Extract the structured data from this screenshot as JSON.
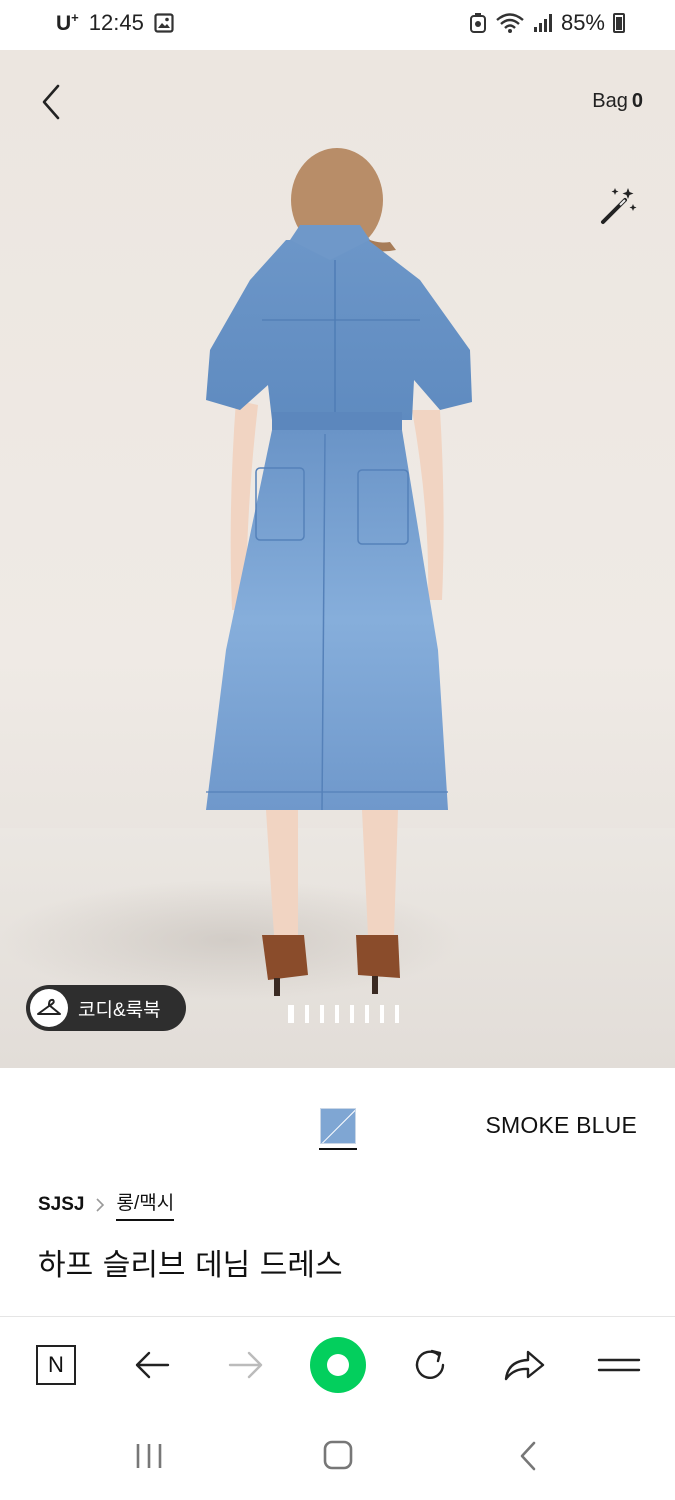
{
  "status_bar": {
    "carrier": "U",
    "carrier_sup": "+",
    "time": "12:45",
    "battery": "85%"
  },
  "header": {
    "bag_label": "Bag",
    "bag_count": "0"
  },
  "hero": {
    "coordi_label": "코디&룩북",
    "image_count": 8,
    "active_index": 0
  },
  "product": {
    "color_name": "SMOKE BLUE",
    "swatch_color": "#7fa6d3",
    "brand": "SJSJ",
    "category": "롱/맥시",
    "title": "하프 슬리브 데님 드레스"
  },
  "browser_toolbar": {
    "naver_label": "N",
    "brand_color": "#03cf5d"
  },
  "icons": {
    "back": "back-arrow-icon",
    "magic": "magic-wand-icon",
    "hanger": "hanger-icon"
  }
}
